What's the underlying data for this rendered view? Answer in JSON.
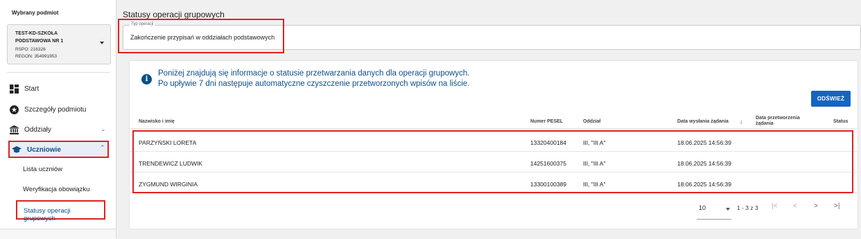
{
  "sidebar": {
    "selected_label": "Wybrany podmiot",
    "entity": {
      "name": "TEST-KD-SZKOŁA PODSTAWOWA NR 1",
      "rspo": "RSPO: 216326",
      "regon": "REGON: 354991953"
    },
    "nav": {
      "start": "Start",
      "details": "Szczegóły podmiotu",
      "units": "Oddziały",
      "students": "Uczniowie",
      "sub": {
        "list": "Lista uczniów",
        "verification": "Weryfikacja obowiązku",
        "statuses": "Statusy operacji grupowych"
      }
    }
  },
  "main": {
    "title": "Statusy operacji grupowych",
    "operation_type": {
      "label": "Typ operacji",
      "value": "Zakończenie przypisań w oddziałach podstawowych"
    },
    "info": {
      "line1": "Poniżej znajdują się informacje o statusie przetwarzania danych dla operacji grupowych.",
      "line2": "Po upływie 7 dni następuje automatyczne czyszczenie przetworzonych wpisów na liście."
    },
    "refresh_label": "ODŚWIEŻ",
    "table": {
      "headers": {
        "name": "Nazwisko i imię",
        "pesel": "Numer PESEL",
        "unit": "Oddział",
        "sent": "Data wysłania żądania",
        "processed": "Data przetworzenia żądania",
        "status": "Status"
      },
      "rows": [
        {
          "name": "PARZYŃSKI LORETA",
          "pesel": "13320400184",
          "unit": "III, \"III A\"",
          "sent": "18.06.2025 14:56:39",
          "processed": "",
          "status": ""
        },
        {
          "name": "TRENDEWICZ LUDWIK",
          "pesel": "14251600375",
          "unit": "III, \"III A\"",
          "sent": "18.06.2025 14:56:39",
          "processed": "",
          "status": ""
        },
        {
          "name": "ZYGMUND WIRGINIA",
          "pesel": "13300100389",
          "unit": "III, \"III A\"",
          "sent": "18.06.2025 14:56:39",
          "processed": "",
          "status": ""
        }
      ]
    },
    "pagination": {
      "page_size": "10",
      "range": "1 - 3 z 3"
    }
  },
  "colors": {
    "primary": "#1565c0",
    "text_blue": "#0b4f8c",
    "highlight_red": "#e02020"
  },
  "icons": {
    "start": "dashboard-icon",
    "details": "badge-icon",
    "units": "building-icon",
    "students": "graduation-cap-icon",
    "info": "info-icon"
  }
}
